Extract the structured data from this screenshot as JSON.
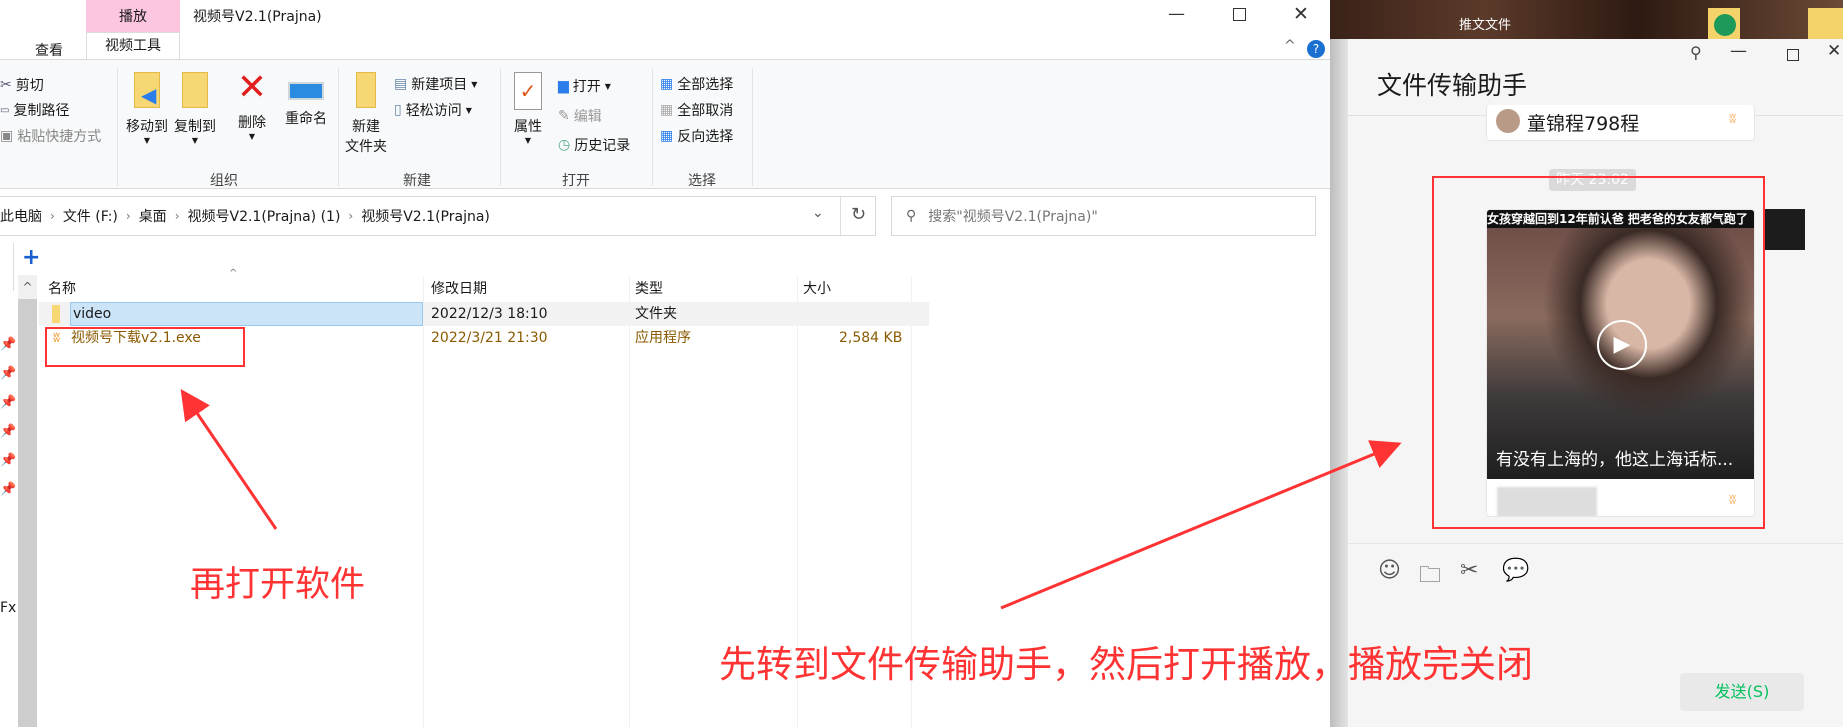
{
  "explorer": {
    "title": "视频号V2.1(Prajna)",
    "context_tab": "播放",
    "tabs": [
      "查看",
      "视频工具"
    ],
    "window_controls": [
      "minimize-icon",
      "maximize-icon",
      "close-icon"
    ],
    "ribbon": {
      "clipboard": [
        "剪切",
        "复制路径",
        "粘贴快捷方式"
      ],
      "organize": {
        "label": "组织",
        "move_to": "移动到",
        "copy_to": "复制到",
        "delete": "删除",
        "rename": "重命名"
      },
      "new": {
        "label": "新建",
        "new_folder_1": "新建",
        "new_folder_2": "文件夹",
        "new_item": "新建项目",
        "easy_access": "轻松访问"
      },
      "open": {
        "label": "打开",
        "properties": "属性",
        "open": "打开",
        "edit": "编辑",
        "history": "历史记录"
      },
      "select": {
        "label": "选择",
        "select_all": "全部选择",
        "select_none": "全部取消",
        "invert": "反向选择"
      }
    },
    "breadcrumb": [
      "此电脑",
      "文件 (F:)",
      "桌面",
      "视频号V2.1(Prajna) (1)",
      "视频号V2.1(Prajna)"
    ],
    "search_placeholder": "搜索\"视频号V2.1(Prajna)\"",
    "columns": [
      "名称",
      "修改日期",
      "类型",
      "大小"
    ],
    "files": [
      {
        "name": "video",
        "date": "2022/12/3 18:10",
        "type": "文件夹",
        "size": ""
      },
      {
        "name": "视频号下载v2.1.exe",
        "date": "2022/3/21 21:30",
        "type": "应用程序",
        "size": "2,584 KB"
      }
    ],
    "left_stub": "Fx"
  },
  "desktop": {
    "folder_label": "推文文件"
  },
  "chat": {
    "title": "文件传输助手",
    "prev_card_name": "童锦程798程",
    "timestamp": "昨天 23:02",
    "video_caption_top": "女孩穿越回到12年前认爸 把老爸的女友都气跑了",
    "video_subtitle": "有没有上海的，他这上海话标...",
    "send_label": "发送(S)"
  },
  "annotations": {
    "left": "再打开软件",
    "bottom": "先转到文件传输助手，然后打开播放，播放完关闭",
    "color": "#ff3333"
  }
}
